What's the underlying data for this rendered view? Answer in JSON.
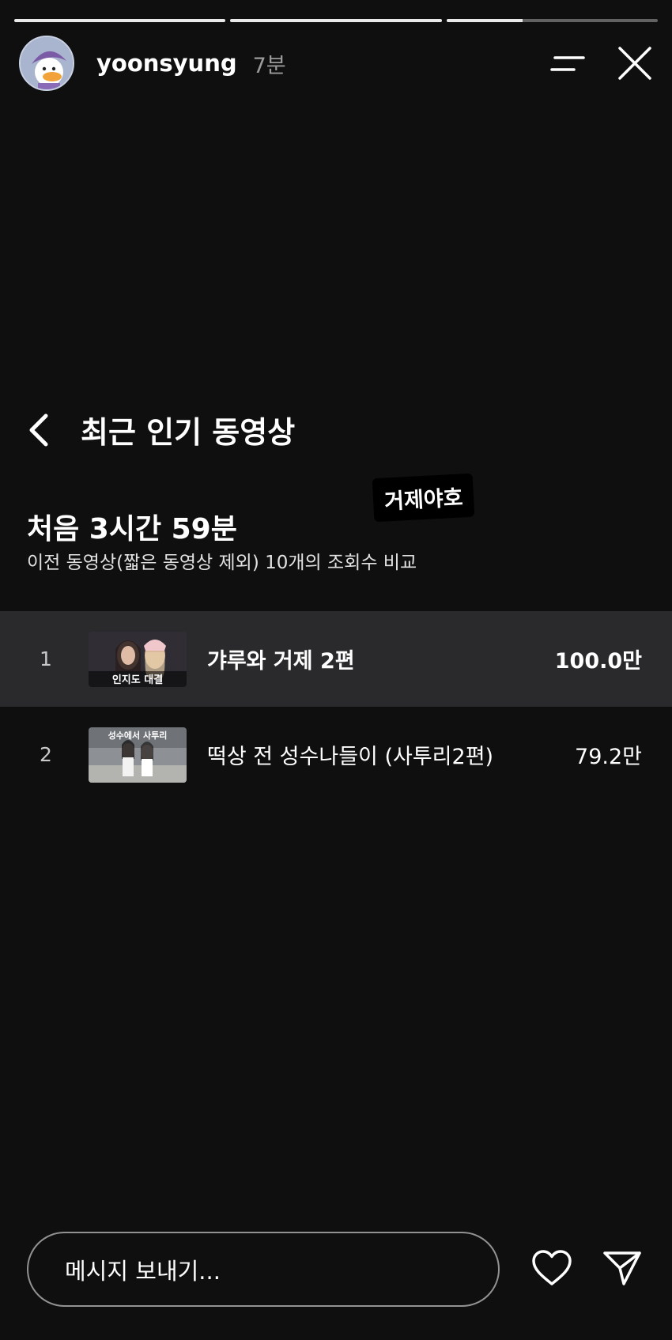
{
  "story": {
    "progress": [
      1.0,
      1.0,
      0.36
    ]
  },
  "header": {
    "username": "yoonsyung",
    "time": "7분"
  },
  "nav": {
    "title": "최근 인기 동영상"
  },
  "sticker": {
    "text": "거제야호"
  },
  "section": {
    "title": "처음 3시간 59분",
    "subtitle": "이전 동영상(짧은 동영상 제외) 10개의 조회수 비교"
  },
  "videos": [
    {
      "rank": "1",
      "title": "갸루와 거제 2편",
      "views": "100.0만",
      "thumb_caption": "인지도 대결"
    },
    {
      "rank": "2",
      "title": "떡상 전 성수나들이 (사투리2편)",
      "views": "79.2만",
      "thumb_caption": "성수에서 사투리"
    }
  ],
  "footer": {
    "message_placeholder": "메시지 보내기..."
  }
}
